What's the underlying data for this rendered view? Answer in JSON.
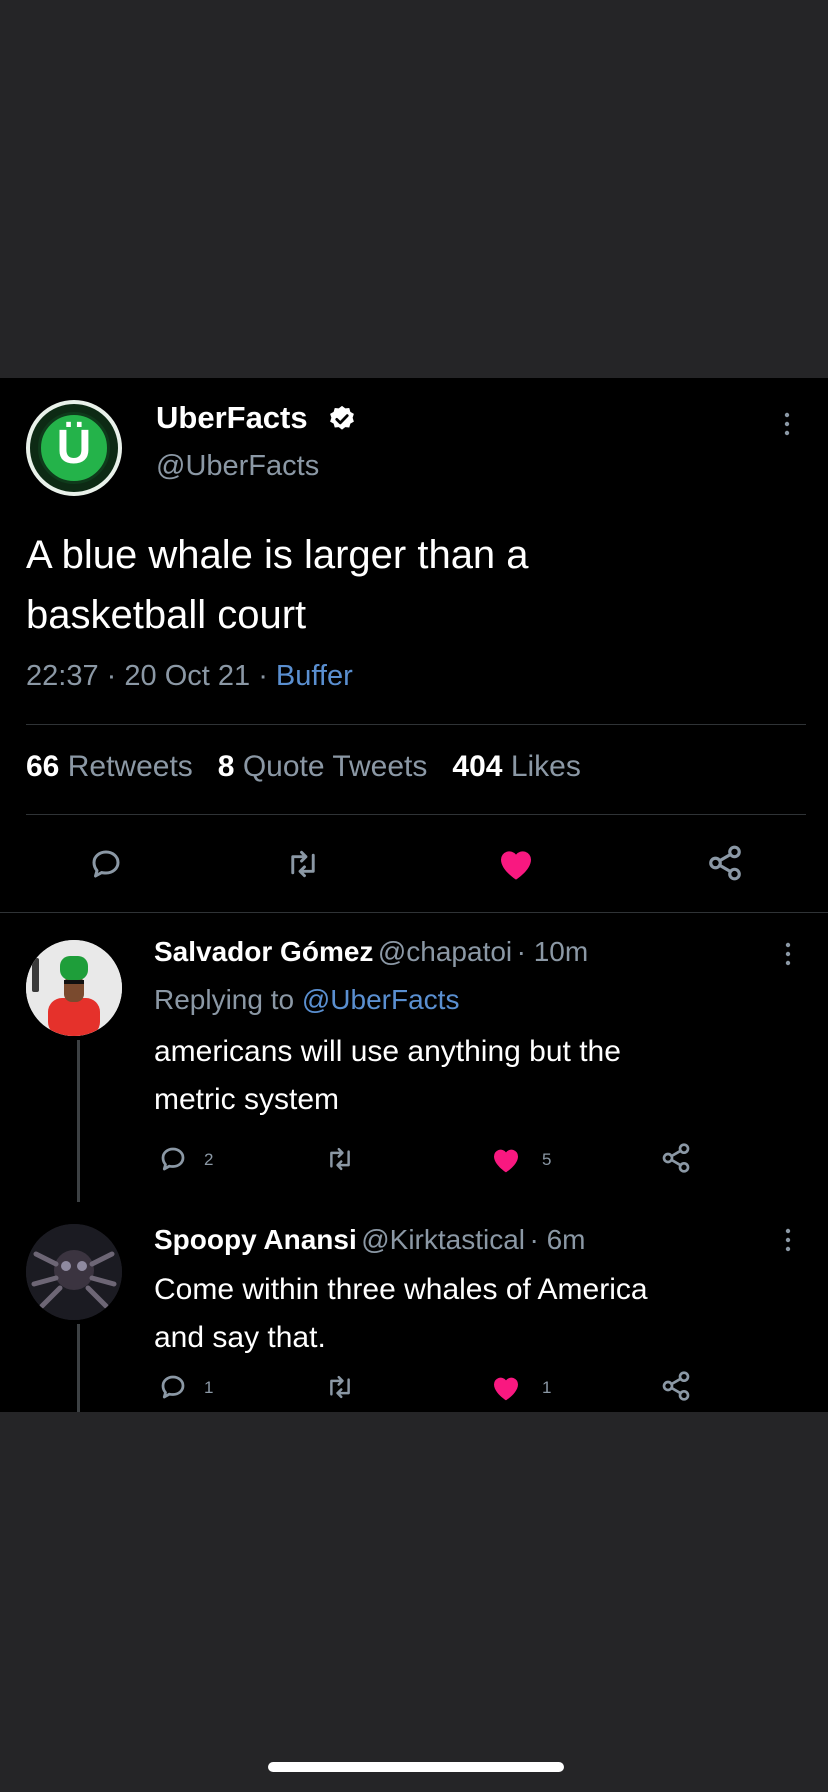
{
  "tweet": {
    "author_name": "UberFacts",
    "author_handle": "@UberFacts",
    "avatar_letter": "Ü",
    "text_line1": "A blue whale is larger than a",
    "text_line2": "basketball court",
    "time": "22:37",
    "date": "20 Oct 21",
    "source": "Buffer",
    "separator": "·",
    "retweets_count": "66",
    "retweets_label": "Retweets",
    "quotes_count": "8",
    "quotes_label": "Quote Tweets",
    "likes_count": "404",
    "likes_label": "Likes"
  },
  "replies": [
    {
      "name": "Salvador Gómez",
      "handle": "@chapatoi",
      "time": "· 10m",
      "replying_prefix": "Replying to",
      "replying_to": "@UberFacts",
      "text_line1": "americans will use anything but the",
      "text_line2": "metric system",
      "reply_count": "2",
      "like_count": "5"
    },
    {
      "name": "Spoopy Anansi",
      "handle": "@Kirktastical",
      "time": "· 6m",
      "text_line1": "Come within three whales of America",
      "text_line2": "and say that.",
      "reply_count": "1",
      "like_count": "1"
    }
  ],
  "icons": {
    "verified": "verified-badge-icon",
    "more": "more-vertical-icon",
    "reply": "reply-bubble-icon",
    "retweet": "retweet-icon",
    "like": "heart-icon",
    "share": "share-icon"
  },
  "colors": {
    "background": "#000000",
    "letterbox": "#252527",
    "like_active": "#f91880",
    "muted": "#8b98a5",
    "link": "#5a8fd0",
    "avatar_green": "#24b34a"
  }
}
